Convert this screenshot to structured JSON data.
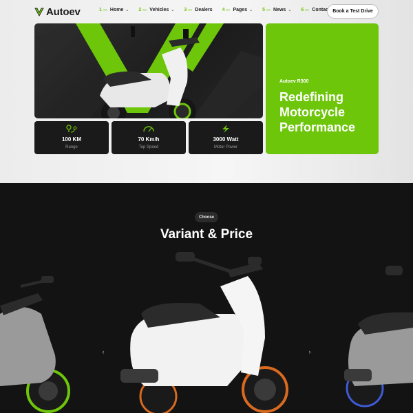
{
  "brand": {
    "name": "Autoev",
    "accent": "#6dc60a"
  },
  "nav": [
    {
      "num": "1",
      "label": "Home",
      "dropdown": true
    },
    {
      "num": "2",
      "label": "Vehicles",
      "dropdown": true
    },
    {
      "num": "3",
      "label": "Dealers",
      "dropdown": false
    },
    {
      "num": "4",
      "label": "Pages",
      "dropdown": true
    },
    {
      "num": "5",
      "label": "News",
      "dropdown": true
    },
    {
      "num": "6",
      "label": "Contact",
      "dropdown": false
    }
  ],
  "header": {
    "cta_label": "Book a Test Drive"
  },
  "hero": {
    "model": "Autoev R300",
    "title": "Redefining Motorcycle Performance",
    "stats": [
      {
        "icon": "location-route-icon",
        "value": "100 KM",
        "label": "Range"
      },
      {
        "icon": "speedometer-icon",
        "value": "70 Km/h",
        "label": "Top Speed"
      },
      {
        "icon": "lightning-icon",
        "value": "3000 Watt",
        "label": "Motor Power"
      }
    ]
  },
  "variants": {
    "chip": "Choose",
    "title": "Variant & Price",
    "prev_symbol": "‹",
    "next_symbol": "›"
  }
}
